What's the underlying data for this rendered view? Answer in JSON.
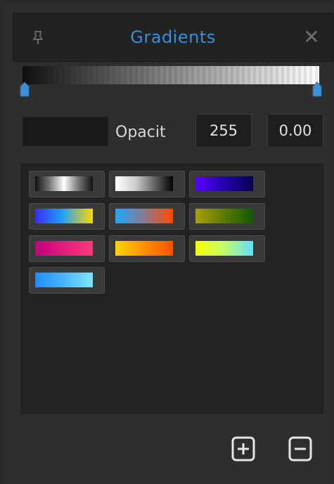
{
  "panel": {
    "title": "Gradients",
    "pin_icon": "pin-icon",
    "close_icon": "close-icon",
    "close_glyph": "✕"
  },
  "editor": {
    "gradient_preview": "black-to-white",
    "opacity_label": "Opacit",
    "opacity_value": "255",
    "position_value": "0.00"
  },
  "presets": [
    {
      "name": "chrome-dark"
    },
    {
      "name": "white-to-black"
    },
    {
      "name": "violet-to-navy"
    },
    {
      "name": "blue-to-yellow"
    },
    {
      "name": "blue-to-orange"
    },
    {
      "name": "olive-to-green"
    },
    {
      "name": "magenta-to-pink"
    },
    {
      "name": "yellow-to-orange"
    },
    {
      "name": "yellow-to-cyan"
    },
    {
      "name": "blue-to-light-cyan"
    }
  ],
  "footer": {
    "add_icon": "plus-square-icon",
    "remove_icon": "minus-square-icon"
  },
  "colors": {
    "accent": "#3a8fd6",
    "panel_bg": "#2e2e2e",
    "library_bg": "#232323"
  }
}
